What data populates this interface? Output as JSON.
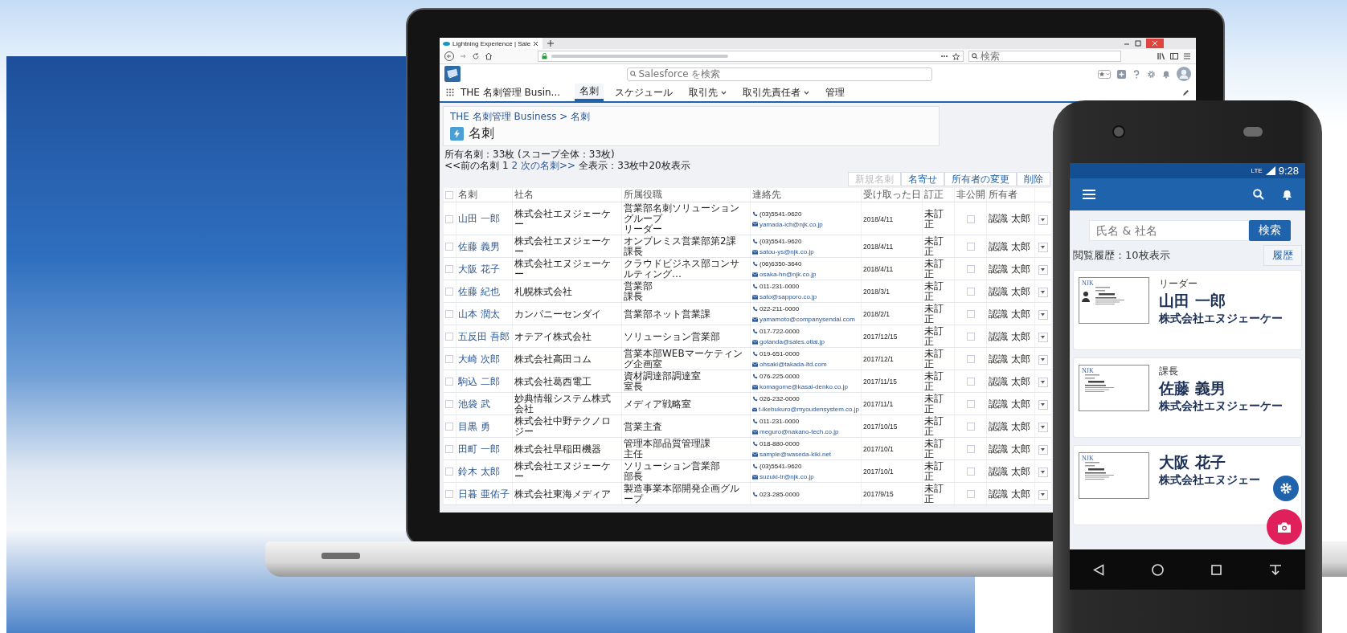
{
  "browser": {
    "tab_title": "Lightning Experience | Sale",
    "search_placeholder": "検索"
  },
  "app": {
    "search_placeholder": "Salesforce を検索",
    "app_name": "THE 名刺管理 Busin...",
    "nav": [
      {
        "label": "名刺",
        "selected": true,
        "dropdown": false
      },
      {
        "label": "スケジュール",
        "selected": false,
        "dropdown": false
      },
      {
        "label": "取引先",
        "selected": false,
        "dropdown": true
      },
      {
        "label": "取引先責任者",
        "selected": false,
        "dropdown": true
      },
      {
        "label": "管理",
        "selected": false,
        "dropdown": false
      }
    ]
  },
  "page": {
    "breadcrumb": "THE 名刺管理 Business > 名刺",
    "title": "名刺",
    "summary": "所有名刺：33枚 (スコープ全体：33枚)",
    "pager": [
      {
        "text": "<<前の名刺 1",
        "link": false
      },
      {
        "text": "2 次の名刺>>",
        "link": true
      },
      {
        "text": "全表示：33枚中20枚表示",
        "link": false
      }
    ]
  },
  "actions": [
    {
      "label": "新規名刺",
      "disabled": true
    },
    {
      "label": "名寄せ",
      "disabled": false
    },
    {
      "label": "所有者の変更",
      "disabled": false
    },
    {
      "label": "削除",
      "disabled": false
    }
  ],
  "table": {
    "select_all": false,
    "columns": [
      "名刺",
      "社名",
      "所属役職",
      "連絡先",
      "受け取った日",
      "訂正",
      "非公開",
      "所有者"
    ],
    "rows": [
      {
        "selected": false,
        "name": "山田 一郎",
        "company": "株式会社エヌジェーケー",
        "position": [
          "営業部名刺ソリューショングループ",
          "リーダー"
        ],
        "phone": "(03)5541-9620",
        "email": "yamada-ich@njk.co.jp",
        "received": "2018/4/11",
        "correction": "未訂正",
        "private": false,
        "owner": "認識 太郎"
      },
      {
        "selected": false,
        "name": "佐藤 義男",
        "company": "株式会社エヌジェーケー",
        "position": [
          "オンプレミス営業部第2課",
          "課長"
        ],
        "phone": "(03)5541-9620",
        "email": "satou-ys@njk.co.jp",
        "received": "2018/4/11",
        "correction": "未訂正",
        "private": false,
        "owner": "認識 太郎"
      },
      {
        "selected": false,
        "name": "大阪 花子",
        "company": "株式会社エヌジェーケー",
        "position": [
          "クラウドビジネス部コンサルティング…"
        ],
        "phone": "(06)6350-3640",
        "email": "osaka-hn@njk.co.jp",
        "received": "2018/4/11",
        "correction": "未訂正",
        "private": false,
        "owner": "認識 太郎"
      },
      {
        "selected": false,
        "name": "佐藤 紀也",
        "company": "札幌株式会社",
        "position": [
          "営業部",
          "課長"
        ],
        "phone": "011-231-0000",
        "email": "sato@sapporo.co.jp",
        "received": "2018/3/1",
        "correction": "未訂正",
        "private": false,
        "owner": "認識 太郎"
      },
      {
        "selected": false,
        "name": "山本 潤太",
        "company": "カンパニーセンダイ",
        "position": [
          "営業部ネット営業課"
        ],
        "phone": "022-211-0000",
        "email": "yamamoto@companysendai.com",
        "received": "2018/2/1",
        "correction": "未訂正",
        "private": false,
        "owner": "認識 太郎"
      },
      {
        "selected": false,
        "name": "五反田 吾郎",
        "company": "オテアイ株式会社",
        "position": [
          "ソリューション営業部"
        ],
        "phone": "017-722-0000",
        "email": "gotanda@sales.otlai.jp",
        "received": "2017/12/15",
        "correction": "未訂正",
        "private": false,
        "owner": "認識 太郎"
      },
      {
        "selected": false,
        "name": "大崎 次郎",
        "company": "株式会社高田コム",
        "position": [
          "営業本部WEBマーケティング企画室"
        ],
        "phone": "019-651-0000",
        "email": "ohsaki@takada-ltd.com",
        "received": "2017/12/1",
        "correction": "未訂正",
        "private": false,
        "owner": "認識 太郎"
      },
      {
        "selected": false,
        "name": "駒込 二郎",
        "company": "株式会社葛西電工",
        "position": [
          "資材調達部調達室",
          "室長"
        ],
        "phone": "076-225-0000",
        "email": "komagome@kasai-denko.co.jp",
        "received": "2017/11/15",
        "correction": "未訂正",
        "private": false,
        "owner": "認識 太郎"
      },
      {
        "selected": false,
        "name": "池袋 武",
        "company": "妙典情報システム株式会社",
        "position": [
          "メディア戦略室"
        ],
        "phone": "026-232-0000",
        "email": "t-ikebukuro@myoudensystem.co.jp",
        "received": "2017/11/1",
        "correction": "未訂正",
        "private": false,
        "owner": "認識 太郎"
      },
      {
        "selected": false,
        "name": "目黒 勇",
        "company": "株式会社中野テクノロジー",
        "position": [
          "営業主査"
        ],
        "phone": "011-231-0000",
        "email": "meguro@nakano-tech.co.jp",
        "received": "2017/10/15",
        "correction": "未訂正",
        "private": false,
        "owner": "認識 太郎"
      },
      {
        "selected": false,
        "name": "田町 一郎",
        "company": "株式会社早稲田機器",
        "position": [
          "管理本部品質管理課",
          "主任"
        ],
        "phone": "018-880-0000",
        "email": "sample@waseda-kiki.net",
        "received": "2017/10/1",
        "correction": "未訂正",
        "private": false,
        "owner": "認識 太郎"
      },
      {
        "selected": false,
        "name": "鈴木 太郎",
        "company": "株式会社エヌジェーケー",
        "position": [
          "ソリューション営業部",
          "部長"
        ],
        "phone": "(03)5541-9620",
        "email": "suzuki-tr@njk.co.jp",
        "received": "2017/10/1",
        "correction": "未訂正",
        "private": false,
        "owner": "認識 太郎"
      },
      {
        "selected": false,
        "name": "日暮 亜佑子",
        "company": "株式会社東海メディア",
        "position": [
          "製造事業本部開発企画グループ"
        ],
        "phone": "023-285-0000",
        "received": "2017/9/15",
        "correction": "未訂正",
        "private": false,
        "owner": "認識 太郎"
      }
    ]
  },
  "phone": {
    "status": {
      "network": "LTE",
      "time": "9:28"
    },
    "search": {
      "placeholder": "氏名 & 社名",
      "button": "検索"
    },
    "history_label": "閲覧履歴：10枚表示",
    "history_button": "履歴",
    "cards": [
      {
        "logo": "NJK",
        "photo": true,
        "title": "リーダー",
        "name": "山田 一郎",
        "company": "株式会社エヌジェーケー"
      },
      {
        "logo": "NJK",
        "photo": false,
        "title": "課長",
        "name": "佐藤 義男",
        "company": "株式会社エヌジェーケー"
      },
      {
        "logo": "NJK",
        "photo": false,
        "name": "大阪 花子",
        "company": "株式会社エヌジェー"
      }
    ]
  }
}
